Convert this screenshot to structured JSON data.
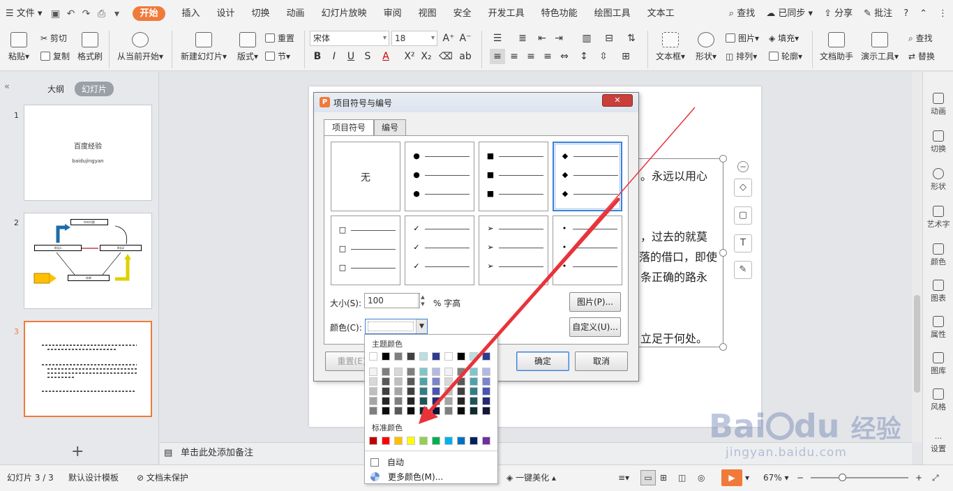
{
  "menubar": {
    "file": "文件",
    "tabs": [
      "开始",
      "插入",
      "设计",
      "切换",
      "动画",
      "幻灯片放映",
      "审阅",
      "视图",
      "安全",
      "开发工具",
      "特色功能",
      "绘图工具",
      "文本工"
    ],
    "active_tab": "开始",
    "search": "查找",
    "synced": "已同步",
    "share": "分享",
    "comment": "批注",
    "help": "?"
  },
  "ribbon": {
    "paste": "粘贴",
    "cut": "剪切",
    "copy": "复制",
    "format_painter": "格式刷",
    "from_current": "从当前开始",
    "new_slide": "新建幻灯片",
    "layout": "版式",
    "reset": "重置",
    "section": "节",
    "font_name": "宋体",
    "font_size": "18",
    "text_box": "文本框",
    "shape": "形状",
    "picture": "图片",
    "fill": "填充",
    "arrange": "排列",
    "outline": "轮廓",
    "doc_assistant": "文档助手",
    "presentation_tools": "演示工具",
    "find": "查找",
    "replace": "替换"
  },
  "left_panel": {
    "tab_outline": "大纲",
    "tab_slides": "幻灯片",
    "slide1": {
      "num": "1",
      "title": "百度经验",
      "subtitle": "baidujingyan"
    },
    "slide2": {
      "num": "2",
      "boxes": [
        "你的问题",
        "原因1",
        "原因2",
        "结果"
      ]
    },
    "slide3": {
      "num": "3"
    },
    "add": "+"
  },
  "slide_text": {
    "line1": "。永远以用心",
    "line2": "，过去的就莫",
    "line3": "落的借口，即使",
    "line4": "条正确的路永",
    "line5": "立足于何处。"
  },
  "notes": {
    "placeholder": "单击此处添加备注"
  },
  "right_rail": [
    "动画",
    "切换",
    "形状",
    "艺术字",
    "颜色",
    "图表",
    "属性",
    "图库",
    "风格",
    "设置"
  ],
  "status": {
    "slide_count": "幻灯片 3 / 3",
    "template": "默认设计模板",
    "protection": "文档未保护",
    "beautify": "一键美化",
    "zoom": "67%"
  },
  "dialog": {
    "title": "项目符号与编号",
    "close": "✕",
    "tab_bullets": "项目符号",
    "tab_numbering": "编号",
    "none_label": "无",
    "bullet_glyphs": [
      "●",
      "■",
      "◆",
      "□",
      "✓",
      "➢",
      "•"
    ],
    "size_label": "大小(S):",
    "size_value": "100",
    "size_unit": "% 字高",
    "color_label": "颜色(C):",
    "picture_btn": "图片(P)...",
    "custom_btn": "自定义(U)...",
    "reset_btn": "重置(E)",
    "ok_btn": "确定",
    "cancel_btn": "取消"
  },
  "color_popup": {
    "theme_header": "主题颜色",
    "standard_header": "标准颜色",
    "auto": "自动",
    "more_colors": "更多颜色(M)...",
    "theme_top": [
      "#ffffff",
      "#000000",
      "#7f7f7f",
      "#404040",
      "#b9e0e3",
      "#2e3a93",
      "#ffffff",
      "#000000",
      "#b9e0e3",
      "#2e3a93"
    ],
    "theme_tints": [
      [
        "#f2f2f2",
        "#7f7f7f",
        "#d8d8d8",
        "#7f7f7f",
        "#7fc6cc",
        "#b4b9e4",
        "#f2f2f2",
        "#7f7f7f",
        "#7fc6cc",
        "#b4b9e4"
      ],
      [
        "#d8d8d8",
        "#595959",
        "#bfbfbf",
        "#595959",
        "#4ea3a9",
        "#7c84cf",
        "#d8d8d8",
        "#595959",
        "#4ea3a9",
        "#7c84cf"
      ],
      [
        "#bfbfbf",
        "#404040",
        "#a5a5a5",
        "#404040",
        "#2f7f85",
        "#4a53b3",
        "#bfbfbf",
        "#404040",
        "#2f7f85",
        "#4a53b3"
      ],
      [
        "#a5a5a5",
        "#262626",
        "#7f7f7f",
        "#262626",
        "#1e5558",
        "#222b6e",
        "#a5a5a5",
        "#262626",
        "#1e5558",
        "#222b6e"
      ],
      [
        "#7f7f7f",
        "#0c0c0c",
        "#595959",
        "#0c0c0c",
        "#0f2a2c",
        "#111637",
        "#7f7f7f",
        "#0c0c0c",
        "#0f2a2c",
        "#111637"
      ]
    ],
    "standard": [
      "#c00000",
      "#ff0000",
      "#ffc000",
      "#ffff00",
      "#92d050",
      "#00b050",
      "#00b0f0",
      "#0070c0",
      "#002060",
      "#7030a0"
    ]
  },
  "annotation": {
    "arrow_color": "#e8333a"
  },
  "watermark": {
    "brand": "Bai",
    "brand2": "du",
    "cn": "经验",
    "url": "jingyan.baidu.com"
  }
}
